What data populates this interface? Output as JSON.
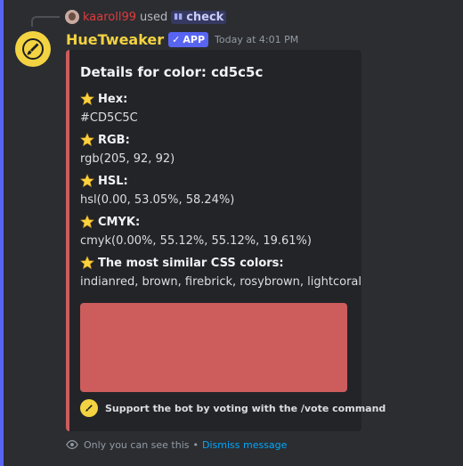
{
  "colors": {
    "accent_bar": "#5865f2",
    "bot_name": "#f3d341",
    "embed_color": "#cd5c5c",
    "link": "#00a8fc",
    "reply_user": "#e03b3b"
  },
  "reply": {
    "username": "kaaroll99",
    "used_text": "used",
    "command_icon": "slash-command-icon",
    "command_name": "check"
  },
  "message": {
    "bot_name": "HueTweaker",
    "badge_label": "APP",
    "badge_icon": "checkmark-icon",
    "timestamp": "Today at 4:01 PM"
  },
  "embed": {
    "title_prefix": "Details for color:",
    "title_value": "cd5c5c",
    "fields": [
      {
        "icon": "star-icon",
        "name": "Hex:",
        "value": "#CD5C5C"
      },
      {
        "icon": "star-icon",
        "name": "RGB:",
        "value": "rgb(205, 92, 92)"
      },
      {
        "icon": "star-icon",
        "name": "HSL:",
        "value": "hsl(0.00, 53.05%, 58.24%)"
      },
      {
        "icon": "star-icon",
        "name": "CMYK:",
        "value": "cmyk(0.00%, 55.12%, 55.12%, 19.61%)"
      },
      {
        "icon": "star-icon",
        "name": "The most similar CSS colors:",
        "value": "indianred, brown, firebrick, rosybrown, lightcoral"
      }
    ],
    "swatch_color": "#cd5c5c",
    "footer_icon": "paintbrush-icon",
    "footer_text": "Support the bot by voting with the /vote command"
  },
  "ephemeral": {
    "icon": "eye-icon",
    "notice": "Only you can see this",
    "separator": "•",
    "dismiss_label": "Dismiss message"
  }
}
